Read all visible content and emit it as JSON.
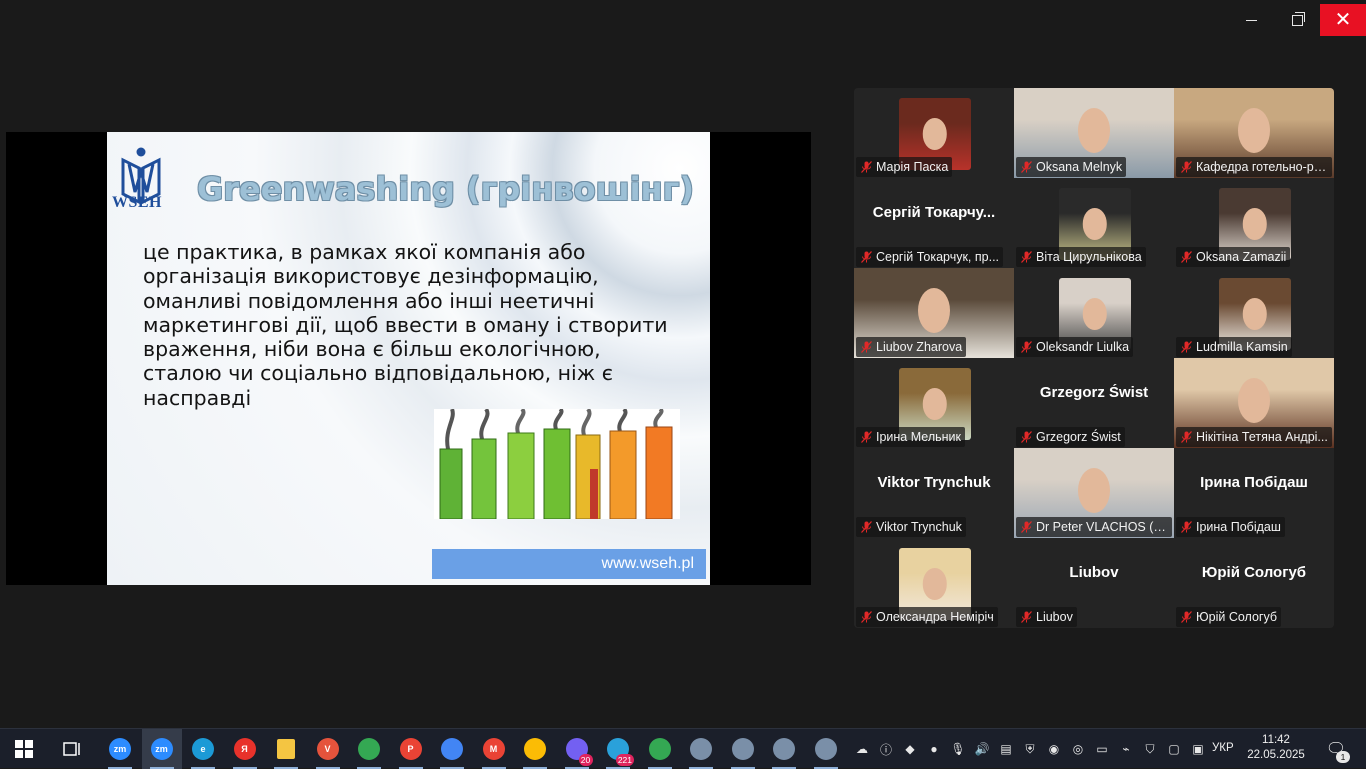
{
  "window": {
    "minimize_icon": "minimize-icon",
    "maximize_icon": "restore-icon",
    "close_glyph": "✕"
  },
  "slide": {
    "logo_text": "WSEH",
    "title": "Greenwashing (грінвошінг)",
    "body_lines": [
      "це практика, в рамках якої компанія або",
      "організація використовує дезінформацію,",
      "оманливі повідомлення або інші неетичні",
      "маркетингові дії, щоб ввести в оману і створити",
      "враження, ніби вона є більш екологічною,",
      "сталою чи соціально відповідальною, ніж є",
      "насправді"
    ],
    "url": "www.wseh.pl"
  },
  "participants": [
    {
      "label": "Марія Паска",
      "center": "",
      "video": "photo"
    },
    {
      "label": "Oksana Melnyk",
      "center": "",
      "video": "full"
    },
    {
      "label": "Кафедра готельно-рест...",
      "center": "",
      "video": "full"
    },
    {
      "label": "Сергій Токарчук, пр...",
      "center": "Сергій  Токарчу...",
      "video": "none"
    },
    {
      "label": "Віта Цирульнікова",
      "center": "",
      "video": "photo"
    },
    {
      "label": "Oksana Zamazii",
      "center": "",
      "video": "photo"
    },
    {
      "label": "Liubov Zharova",
      "center": "",
      "video": "full",
      "active": true
    },
    {
      "label": "Oleksandr Liulka",
      "center": "",
      "video": "photo"
    },
    {
      "label": "Ludmilla Kamsin",
      "center": "",
      "video": "photo"
    },
    {
      "label": "Ірина Мельник",
      "center": "",
      "video": "photo"
    },
    {
      "label": "Grzegorz Świst",
      "center": "Grzegorz Świst",
      "video": "none"
    },
    {
      "label": "Нікітіна Тетяна Андрі...",
      "center": "",
      "video": "full"
    },
    {
      "label": "Viktor Trynchuk",
      "center": "Viktor Trynchuk",
      "video": "none"
    },
    {
      "label": "Dr Peter VLACHOS (U...",
      "center": "",
      "video": "full"
    },
    {
      "label": "Ірина Побідаш",
      "center": "Ірина Побідаш",
      "video": "none"
    },
    {
      "label": "Олександра Немірiч",
      "center": "",
      "video": "photo"
    },
    {
      "label": "Liubov",
      "center": "Liubov",
      "video": "none"
    },
    {
      "label": "Юрій Сологуб",
      "center": "Юрій Сологуб",
      "video": "none"
    }
  ],
  "taskbar": {
    "apps": [
      {
        "name": "zoom-icon",
        "text": "zm",
        "color": "#2d8cff"
      },
      {
        "name": "zoom-icon",
        "text": "zm",
        "color": "#2d8cff"
      },
      {
        "name": "edge-icon",
        "text": "e",
        "color": "#1c9ad6"
      },
      {
        "name": "yandex-browser-icon",
        "text": "Я",
        "color": "#e8322b"
      },
      {
        "name": "file-explorer-icon",
        "text": "",
        "color": "#f4c542"
      },
      {
        "name": "vivaldi-icon",
        "text": "V",
        "color": "#e5533c"
      },
      {
        "name": "chrome-icon",
        "text": "",
        "color": "#34a853"
      },
      {
        "name": "chrome-icon",
        "text": "P",
        "color": "#ea4335"
      },
      {
        "name": "chrome-icon",
        "text": "",
        "color": "#4285f4"
      },
      {
        "name": "chrome-icon",
        "text": "M",
        "color": "#ea4335"
      },
      {
        "name": "chrome-icon",
        "text": "",
        "color": "#fbbc05"
      },
      {
        "name": "viber-icon",
        "text": "",
        "color": "#7360f2",
        "badge": "20"
      },
      {
        "name": "telegram-icon",
        "text": "",
        "color": "#2aa1da",
        "badge": "221"
      },
      {
        "name": "chrome-icon",
        "text": "",
        "color": "#34a853"
      },
      {
        "name": "paint-icon",
        "text": "",
        "color": "#7a8fa8"
      },
      {
        "name": "paint-icon",
        "text": "",
        "color": "#7a8fa8"
      },
      {
        "name": "paint-icon",
        "text": "",
        "color": "#7a8fa8"
      },
      {
        "name": "paint-icon",
        "text": "",
        "color": "#7a8fa8"
      }
    ],
    "language": "УКР",
    "time": "11:42",
    "date": "22.05.2025",
    "notification_badge": "1"
  },
  "colors": {
    "active_speaker": "#23d959",
    "close_button": "#e81123",
    "url_bar": "#6aa0e6"
  }
}
